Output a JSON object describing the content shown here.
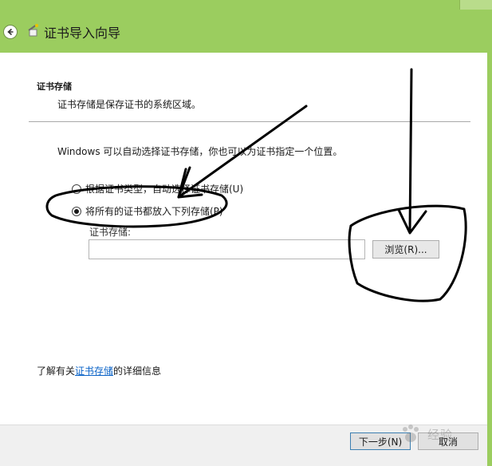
{
  "titlebar": {
    "title": "证书导入向导"
  },
  "section": {
    "title": "证书存储",
    "subtitle": "证书存储是保存证书的系统区域。"
  },
  "intro": "Windows 可以自动选择证书存储，你也可以为证书指定一个位置。",
  "options": [
    {
      "label": "根据证书类型，自动选择证书存储(U)",
      "selected": false
    },
    {
      "label": "将所有的证书都放入下列存储(P)",
      "selected": true
    }
  ],
  "store": {
    "label": "证书存储:",
    "value": ""
  },
  "browse_label": "浏览(R)...",
  "more_info": {
    "prefix": "了解有关",
    "link": "证书存储",
    "suffix": "的详细信息"
  },
  "footer": {
    "next_label": "下一步(N)",
    "cancel_label": "取消"
  },
  "watermark": "经验",
  "colors": {
    "title_bar": "#9bcd5f",
    "link": "#0b63c7",
    "annotation": "#000000"
  }
}
